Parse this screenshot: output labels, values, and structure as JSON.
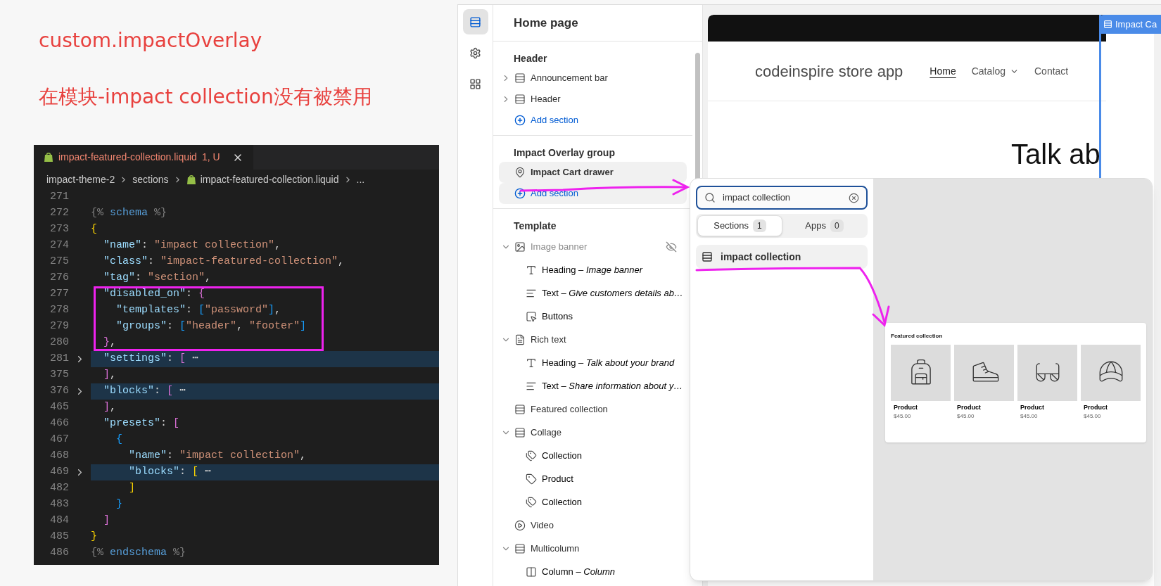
{
  "annotations": {
    "title": "custom.impactOverlay",
    "note": "在模块-impact collection没有被禁用"
  },
  "editor": {
    "tab": {
      "file": "impact-featured-collection.liquid",
      "status": "1, U"
    },
    "breadcrumb": [
      {
        "text": "impact-theme-2",
        "kind": "folder"
      },
      {
        "text": "sections",
        "kind": "folder"
      },
      {
        "text": "impact-featured-collection.liquid",
        "kind": "file"
      },
      {
        "text": "...",
        "kind": "more"
      }
    ],
    "lines": [
      {
        "number": "271",
        "folded": false
      },
      {
        "number": "272",
        "code": "{% schema %}",
        "folded": false
      },
      {
        "number": "273",
        "code": "{",
        "folded": false
      },
      {
        "number": "274",
        "code": "  \"name\": \"impact collection\",",
        "folded": false
      },
      {
        "number": "275",
        "code": "  \"class\": \"impact-featured-collection\",",
        "folded": false
      },
      {
        "number": "276",
        "code": "  \"tag\": \"section\",",
        "folded": false
      },
      {
        "number": "277",
        "code": "  \"disabled_on\": {",
        "folded": false
      },
      {
        "number": "278",
        "code": "    \"templates\": [\"password\"],",
        "folded": false
      },
      {
        "number": "279",
        "code": "    \"groups\": [\"header\", \"footer\"]",
        "folded": false
      },
      {
        "number": "280",
        "code": "  },",
        "folded": false
      },
      {
        "number": "281",
        "code": "  \"settings\": [ ⋯",
        "folded": true
      },
      {
        "number": "375",
        "code": "  ],",
        "folded": false
      },
      {
        "number": "376",
        "code": "  \"blocks\": [ ⋯",
        "folded": true
      },
      {
        "number": "465",
        "code": "  ],",
        "folded": false
      },
      {
        "number": "466",
        "code": "  \"presets\": [",
        "folded": false
      },
      {
        "number": "467",
        "code": "    {",
        "folded": false
      },
      {
        "number": "468",
        "code": "      \"name\": \"impact collection\",",
        "folded": false
      },
      {
        "number": "469",
        "code": "      \"blocks\": [ ⋯",
        "folded": true
      },
      {
        "number": "482",
        "code": "      ]",
        "folded": false
      },
      {
        "number": "483",
        "code": "    }",
        "folded": false
      },
      {
        "number": "484",
        "code": "  ]",
        "folded": false
      },
      {
        "number": "485",
        "code": "}",
        "folded": false
      },
      {
        "number": "486",
        "code": "{% endschema %}",
        "folded": false
      }
    ]
  },
  "rail": [
    {
      "selected": true
    },
    {
      "selected": false
    },
    {
      "selected": false
    }
  ],
  "sidebar": {
    "title": "Home page",
    "groups": [
      {
        "title": "Header",
        "items": [
          {
            "label": "Announcement bar",
            "kind": "header-section",
            "expanded": false,
            "highlighted": false
          },
          {
            "label": "Header",
            "kind": "header-section",
            "expanded": false,
            "highlighted": false
          }
        ],
        "add": {
          "label": "Add section",
          "highlighted": false
        }
      },
      {
        "title": "Impact Overlay group",
        "items": [
          {
            "label": "Impact Cart drawer",
            "kind": "pin",
            "highlighted": true
          }
        ],
        "add": {
          "label": "Add section",
          "highlighted": true
        }
      },
      {
        "title": "Template",
        "items": [
          {
            "label": "Image banner",
            "kind": "image",
            "expanded": true,
            "hidden": true,
            "highlighted": false,
            "children": [
              {
                "label": "Heading – *Image banner*",
                "kind": "heading"
              },
              {
                "label": "Text – *Give customers details ab…*",
                "kind": "text"
              },
              {
                "label": "Buttons",
                "kind": "buttons"
              }
            ]
          },
          {
            "label": "Rich text",
            "kind": "richtext",
            "expanded": true,
            "hidden": false,
            "highlighted": false,
            "children": [
              {
                "label": "Heading – *Talk about your brand*",
                "kind": "heading"
              },
              {
                "label": "Text – *Share information about y…*",
                "kind": "text"
              }
            ]
          },
          {
            "label": "Featured collection",
            "kind": "section",
            "hidden": false,
            "highlighted": false
          },
          {
            "label": "Collage",
            "kind": "section",
            "expanded": true,
            "hidden": false,
            "highlighted": false,
            "children": [
              {
                "label": "Collection",
                "kind": "tags"
              },
              {
                "label": "Product",
                "kind": "tag"
              },
              {
                "label": "Collection",
                "kind": "tags"
              }
            ]
          },
          {
            "label": "Video",
            "kind": "video",
            "hidden": false,
            "highlighted": false
          },
          {
            "label": "Multicolumn",
            "kind": "section",
            "expanded": true,
            "hidden": false,
            "highlighted": false,
            "children": [
              {
                "label": "Column – *Column*",
                "kind": "column"
              }
            ]
          }
        ]
      }
    ]
  },
  "preview": {
    "store_name": "codeinspire store app",
    "nav": [
      {
        "label": "Home",
        "selected": true,
        "dropdown": false
      },
      {
        "label": "Catalog",
        "selected": false,
        "dropdown": true
      },
      {
        "label": "Contact",
        "selected": false,
        "dropdown": false
      }
    ],
    "heading": "Talk ab",
    "overlay_label": "Impact Ca"
  },
  "popup": {
    "search": {
      "value": "impact collection"
    },
    "tabs": [
      {
        "label": "Sections",
        "count": "1",
        "selected": true
      },
      {
        "label": "Apps",
        "count": "0",
        "selected": false
      }
    ],
    "results": [
      {
        "label": "impact collection",
        "highlighted": true
      }
    ],
    "preview": {
      "title": "Featured collection",
      "products": [
        {
          "name": "Product",
          "price": "$45.00"
        },
        {
          "name": "Product",
          "price": "$45.00"
        },
        {
          "name": "Product",
          "price": "$45.00"
        },
        {
          "name": "Product",
          "price": "$45.00"
        }
      ]
    }
  }
}
